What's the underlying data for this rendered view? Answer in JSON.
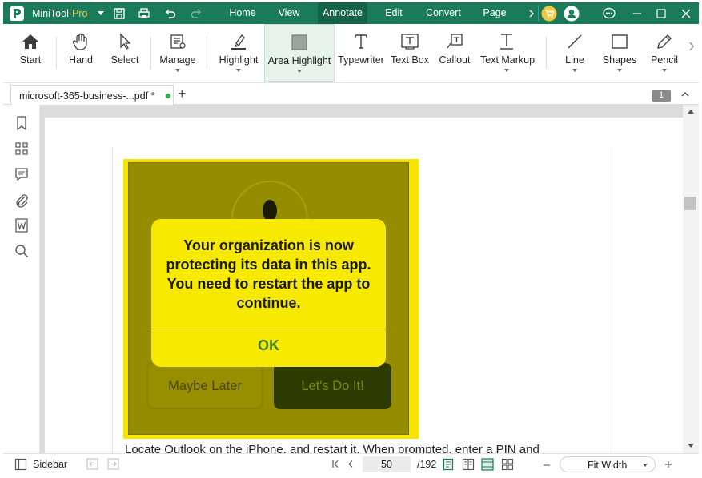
{
  "app": {
    "name": "MiniTool",
    "edition": "-Pro",
    "brand_color": "#1a7a5a",
    "accent_color": "#f5c842"
  },
  "menu": {
    "tabs": [
      "Home",
      "View",
      "Annotate",
      "Edit",
      "Convert",
      "Page"
    ],
    "active_tab": "Annotate"
  },
  "ribbon": {
    "tools": [
      {
        "label": "Start",
        "icon": "home-icon"
      },
      {
        "label": "Hand",
        "icon": "hand-icon"
      },
      {
        "label": "Select",
        "icon": "cursor-icon"
      },
      {
        "label": "Manage",
        "icon": "manage-icon"
      },
      {
        "label": "Highlight",
        "icon": "highlight-icon"
      },
      {
        "label": "Area Highlight",
        "icon": "area-highlight-icon"
      },
      {
        "label": "Typewriter",
        "icon": "typewriter-icon"
      },
      {
        "label": "Text Box",
        "icon": "text-box-icon"
      },
      {
        "label": "Callout",
        "icon": "callout-icon"
      },
      {
        "label": "Text Markup",
        "icon": "text-markup-icon"
      },
      {
        "label": "Line",
        "icon": "line-icon"
      },
      {
        "label": "Shapes",
        "icon": "shapes-icon"
      },
      {
        "label": "Pencil",
        "icon": "pencil-icon"
      }
    ],
    "active_tool": "Area Highlight"
  },
  "document_tab": {
    "label": "microsoft-365-business-...pdf *",
    "page_badge": "1"
  },
  "document": {
    "dialog_message": "Your organization is now protecting its data in this app. You need to restart the app to continue.",
    "dialog_ok": "OK",
    "button_later": "Maybe Later",
    "button_doit": "Let's Do It!",
    "body_text": "Locate Outlook on the iPhone, and restart it. When prompted, enter a PIN and",
    "highlight_color": "#f5e500"
  },
  "statusbar": {
    "sidebar_label": "Sidebar",
    "current_page": "50",
    "total_pages": "/192",
    "zoom": "Fit Width"
  }
}
